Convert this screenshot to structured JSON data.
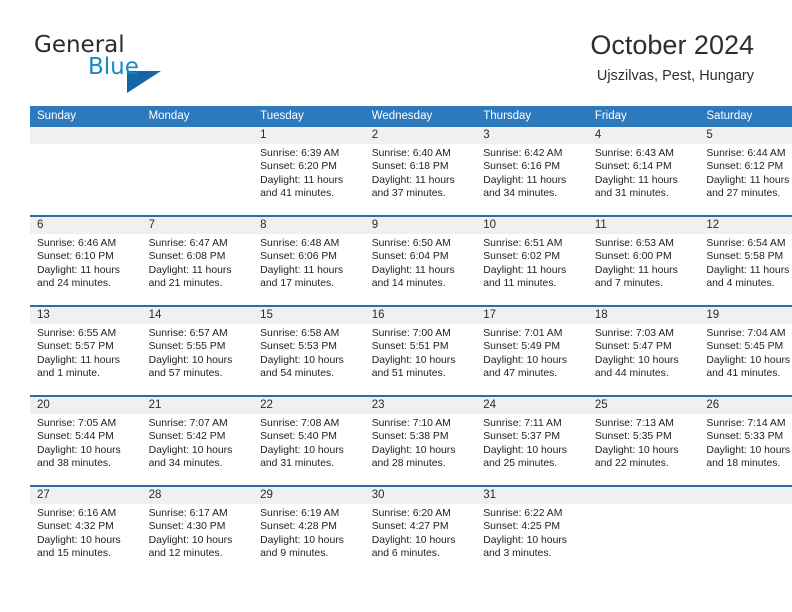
{
  "brand": {
    "name_part1": "General",
    "name_part2": "Blue",
    "accent_color": "#1b87c9",
    "triangle_color": "#1466a8"
  },
  "header": {
    "title": "October 2024",
    "location": "Ujszilvas, Pest, Hungary"
  },
  "calendar": {
    "header_bg": "#2d79bd",
    "row_border_color": "#2d6ca8",
    "daynum_band_bg": "#f0f0f0",
    "weekday_headers": [
      "Sunday",
      "Monday",
      "Tuesday",
      "Wednesday",
      "Thursday",
      "Friday",
      "Saturday"
    ],
    "weeks": [
      [
        {
          "day": "",
          "sunrise": "",
          "sunset": "",
          "daylight_line1": "",
          "daylight_line2": ""
        },
        {
          "day": "",
          "sunrise": "",
          "sunset": "",
          "daylight_line1": "",
          "daylight_line2": ""
        },
        {
          "day": "1",
          "sunrise": "Sunrise: 6:39 AM",
          "sunset": "Sunset: 6:20 PM",
          "daylight_line1": "Daylight: 11 hours",
          "daylight_line2": "and 41 minutes."
        },
        {
          "day": "2",
          "sunrise": "Sunrise: 6:40 AM",
          "sunset": "Sunset: 6:18 PM",
          "daylight_line1": "Daylight: 11 hours",
          "daylight_line2": "and 37 minutes."
        },
        {
          "day": "3",
          "sunrise": "Sunrise: 6:42 AM",
          "sunset": "Sunset: 6:16 PM",
          "daylight_line1": "Daylight: 11 hours",
          "daylight_line2": "and 34 minutes."
        },
        {
          "day": "4",
          "sunrise": "Sunrise: 6:43 AM",
          "sunset": "Sunset: 6:14 PM",
          "daylight_line1": "Daylight: 11 hours",
          "daylight_line2": "and 31 minutes."
        },
        {
          "day": "5",
          "sunrise": "Sunrise: 6:44 AM",
          "sunset": "Sunset: 6:12 PM",
          "daylight_line1": "Daylight: 11 hours",
          "daylight_line2": "and 27 minutes."
        }
      ],
      [
        {
          "day": "6",
          "sunrise": "Sunrise: 6:46 AM",
          "sunset": "Sunset: 6:10 PM",
          "daylight_line1": "Daylight: 11 hours",
          "daylight_line2": "and 24 minutes."
        },
        {
          "day": "7",
          "sunrise": "Sunrise: 6:47 AM",
          "sunset": "Sunset: 6:08 PM",
          "daylight_line1": "Daylight: 11 hours",
          "daylight_line2": "and 21 minutes."
        },
        {
          "day": "8",
          "sunrise": "Sunrise: 6:48 AM",
          "sunset": "Sunset: 6:06 PM",
          "daylight_line1": "Daylight: 11 hours",
          "daylight_line2": "and 17 minutes."
        },
        {
          "day": "9",
          "sunrise": "Sunrise: 6:50 AM",
          "sunset": "Sunset: 6:04 PM",
          "daylight_line1": "Daylight: 11 hours",
          "daylight_line2": "and 14 minutes."
        },
        {
          "day": "10",
          "sunrise": "Sunrise: 6:51 AM",
          "sunset": "Sunset: 6:02 PM",
          "daylight_line1": "Daylight: 11 hours",
          "daylight_line2": "and 11 minutes."
        },
        {
          "day": "11",
          "sunrise": "Sunrise: 6:53 AM",
          "sunset": "Sunset: 6:00 PM",
          "daylight_line1": "Daylight: 11 hours",
          "daylight_line2": "and 7 minutes."
        },
        {
          "day": "12",
          "sunrise": "Sunrise: 6:54 AM",
          "sunset": "Sunset: 5:58 PM",
          "daylight_line1": "Daylight: 11 hours",
          "daylight_line2": "and 4 minutes."
        }
      ],
      [
        {
          "day": "13",
          "sunrise": "Sunrise: 6:55 AM",
          "sunset": "Sunset: 5:57 PM",
          "daylight_line1": "Daylight: 11 hours",
          "daylight_line2": "and 1 minute."
        },
        {
          "day": "14",
          "sunrise": "Sunrise: 6:57 AM",
          "sunset": "Sunset: 5:55 PM",
          "daylight_line1": "Daylight: 10 hours",
          "daylight_line2": "and 57 minutes."
        },
        {
          "day": "15",
          "sunrise": "Sunrise: 6:58 AM",
          "sunset": "Sunset: 5:53 PM",
          "daylight_line1": "Daylight: 10 hours",
          "daylight_line2": "and 54 minutes."
        },
        {
          "day": "16",
          "sunrise": "Sunrise: 7:00 AM",
          "sunset": "Sunset: 5:51 PM",
          "daylight_line1": "Daylight: 10 hours",
          "daylight_line2": "and 51 minutes."
        },
        {
          "day": "17",
          "sunrise": "Sunrise: 7:01 AM",
          "sunset": "Sunset: 5:49 PM",
          "daylight_line1": "Daylight: 10 hours",
          "daylight_line2": "and 47 minutes."
        },
        {
          "day": "18",
          "sunrise": "Sunrise: 7:03 AM",
          "sunset": "Sunset: 5:47 PM",
          "daylight_line1": "Daylight: 10 hours",
          "daylight_line2": "and 44 minutes."
        },
        {
          "day": "19",
          "sunrise": "Sunrise: 7:04 AM",
          "sunset": "Sunset: 5:45 PM",
          "daylight_line1": "Daylight: 10 hours",
          "daylight_line2": "and 41 minutes."
        }
      ],
      [
        {
          "day": "20",
          "sunrise": "Sunrise: 7:05 AM",
          "sunset": "Sunset: 5:44 PM",
          "daylight_line1": "Daylight: 10 hours",
          "daylight_line2": "and 38 minutes."
        },
        {
          "day": "21",
          "sunrise": "Sunrise: 7:07 AM",
          "sunset": "Sunset: 5:42 PM",
          "daylight_line1": "Daylight: 10 hours",
          "daylight_line2": "and 34 minutes."
        },
        {
          "day": "22",
          "sunrise": "Sunrise: 7:08 AM",
          "sunset": "Sunset: 5:40 PM",
          "daylight_line1": "Daylight: 10 hours",
          "daylight_line2": "and 31 minutes."
        },
        {
          "day": "23",
          "sunrise": "Sunrise: 7:10 AM",
          "sunset": "Sunset: 5:38 PM",
          "daylight_line1": "Daylight: 10 hours",
          "daylight_line2": "and 28 minutes."
        },
        {
          "day": "24",
          "sunrise": "Sunrise: 7:11 AM",
          "sunset": "Sunset: 5:37 PM",
          "daylight_line1": "Daylight: 10 hours",
          "daylight_line2": "and 25 minutes."
        },
        {
          "day": "25",
          "sunrise": "Sunrise: 7:13 AM",
          "sunset": "Sunset: 5:35 PM",
          "daylight_line1": "Daylight: 10 hours",
          "daylight_line2": "and 22 minutes."
        },
        {
          "day": "26",
          "sunrise": "Sunrise: 7:14 AM",
          "sunset": "Sunset: 5:33 PM",
          "daylight_line1": "Daylight: 10 hours",
          "daylight_line2": "and 18 minutes."
        }
      ],
      [
        {
          "day": "27",
          "sunrise": "Sunrise: 6:16 AM",
          "sunset": "Sunset: 4:32 PM",
          "daylight_line1": "Daylight: 10 hours",
          "daylight_line2": "and 15 minutes."
        },
        {
          "day": "28",
          "sunrise": "Sunrise: 6:17 AM",
          "sunset": "Sunset: 4:30 PM",
          "daylight_line1": "Daylight: 10 hours",
          "daylight_line2": "and 12 minutes."
        },
        {
          "day": "29",
          "sunrise": "Sunrise: 6:19 AM",
          "sunset": "Sunset: 4:28 PM",
          "daylight_line1": "Daylight: 10 hours",
          "daylight_line2": "and 9 minutes."
        },
        {
          "day": "30",
          "sunrise": "Sunrise: 6:20 AM",
          "sunset": "Sunset: 4:27 PM",
          "daylight_line1": "Daylight: 10 hours",
          "daylight_line2": "and 6 minutes."
        },
        {
          "day": "31",
          "sunrise": "Sunrise: 6:22 AM",
          "sunset": "Sunset: 4:25 PM",
          "daylight_line1": "Daylight: 10 hours",
          "daylight_line2": "and 3 minutes."
        },
        {
          "day": "",
          "sunrise": "",
          "sunset": "",
          "daylight_line1": "",
          "daylight_line2": ""
        },
        {
          "day": "",
          "sunrise": "",
          "sunset": "",
          "daylight_line1": "",
          "daylight_line2": ""
        }
      ]
    ]
  }
}
